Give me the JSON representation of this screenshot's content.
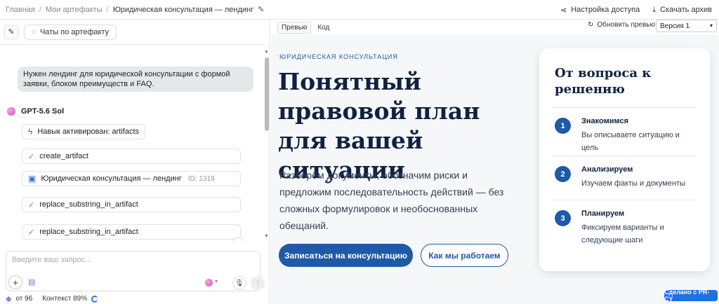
{
  "breadcrumb": {
    "home": "Главная",
    "artifacts": "Мои артефакты",
    "current": "Юридическая консультация — лендинг"
  },
  "topright": {
    "access": "Настройка доступа",
    "download": "Скачать архив"
  },
  "left": {
    "chats_button": "Чаты по артефакту",
    "user_message": "Нужен лендинг для юридической консультации с формой заявки, блоком преимуществ и FAQ.",
    "model_name": "GPT-5.6 Sol",
    "skill_activated": "Навык активирован: artifacts",
    "tool1": "create_artifact",
    "artifact_name": "Юридическая консультация — лендинг",
    "artifact_id": "ID: 1319",
    "tool2": "replace_substring_in_artifact",
    "tool3": "replace_substring_in_artifact",
    "input_placeholder": "Введите ваш запрос...",
    "balance": "от 96",
    "context": "Контекст 89%"
  },
  "preview_bar": {
    "tab_preview": "Превью",
    "tab_code": "Код",
    "refresh": "Обновить превью",
    "version": "Версия 1"
  },
  "landing": {
    "eyebrow": "ЮРИДИЧЕСКАЯ КОНСУЛЬТАЦИЯ",
    "hero": "Понятный правовой план для вашей ситуации",
    "lead": "Разберём документы, обозначим риски и предложим последовательность действий — без сложных формулировок и необоснованных обещаний.",
    "cta_primary": "Записаться на консультацию",
    "cta_secondary": "Как мы работаем",
    "card_title": "От вопроса к решению",
    "steps": [
      {
        "num": "1",
        "title": "Знакомимся",
        "desc": "Вы описываете ситуацию и цель"
      },
      {
        "num": "2",
        "title": "Анализируем",
        "desc": "Изучаем факты и документы"
      },
      {
        "num": "3",
        "title": "Планируем",
        "desc": "Фиксируем варианты и следующие шаги"
      }
    ]
  },
  "badge": "Сделано с PR-CY",
  "colors": {
    "accent": "#1e5aa6",
    "heading": "#0f2340",
    "badge": "#1f6fe5"
  }
}
